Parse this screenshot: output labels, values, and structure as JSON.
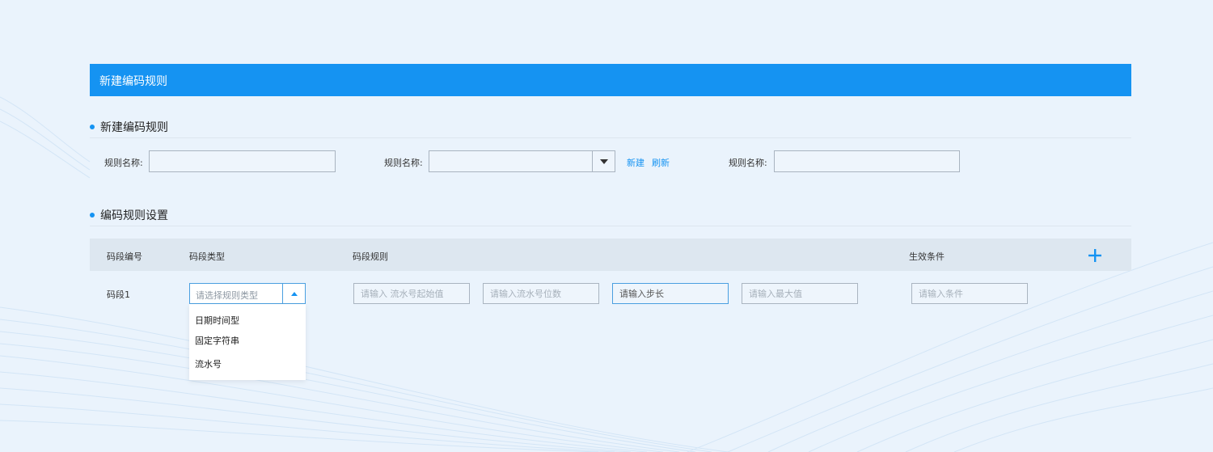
{
  "header": {
    "title": "新建编码规则"
  },
  "section_new": {
    "title": "新建编码规则",
    "field1_label": "规则名称:",
    "field1_value": "",
    "field2_label": "规则名称:",
    "field2_value": "",
    "link_new": "新建",
    "link_refresh": "刷新",
    "field3_label": "规则名称:",
    "field3_value": ""
  },
  "section_settings": {
    "title": "编码规则设置",
    "columns": [
      "码段编号",
      "码段类型",
      "码段规则",
      "生效条件"
    ],
    "row": {
      "label": "码段1",
      "type_placeholder": "请选择规则类型",
      "start_placeholder": "请输入 流水号起始值",
      "digits_placeholder": "请输入流水号位数",
      "step_placeholder": "请输入步长",
      "max_placeholder": "请输入最大值",
      "condition_placeholder": "请输入条件"
    },
    "dropdown_options": [
      "日期时间型",
      "固定字符串",
      "流水号"
    ]
  },
  "colors": {
    "accent": "#1593f2",
    "page_bg": "#eaf3fc",
    "table_header_bg": "#dde7f0"
  }
}
